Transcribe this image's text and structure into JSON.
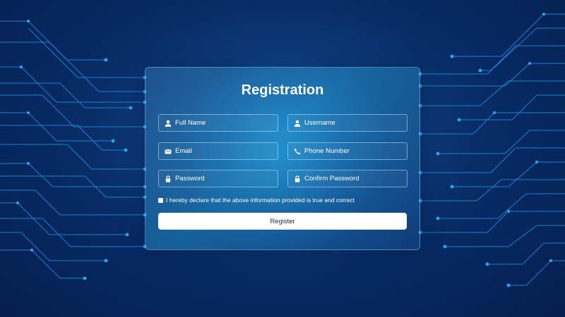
{
  "form": {
    "title": "Registration",
    "fields": [
      {
        "name": "full_name",
        "placeholder": "Full Name",
        "icon": "user-icon"
      },
      {
        "name": "username",
        "placeholder": "Username",
        "icon": "user-icon"
      },
      {
        "name": "email",
        "placeholder": "Email",
        "icon": "envelope-icon"
      },
      {
        "name": "phone",
        "placeholder": "Phone Number",
        "icon": "phone-icon"
      },
      {
        "name": "password",
        "placeholder": "Password",
        "icon": "lock-icon"
      },
      {
        "name": "confirm_password",
        "placeholder": "Confirm Password",
        "icon": "lock-icon"
      }
    ],
    "declaration": "I hereby declare that the above information provided is true and correct",
    "submit_label": "Register"
  },
  "colors": {
    "background_dark": "#051f4f",
    "background_mid": "#0d3a78",
    "circuit_line": "#1e8fe0",
    "circuit_node": "#2aa7f2",
    "button_bg": "#ffffff",
    "button_text": "#1b2a45",
    "text": "#ffffff"
  }
}
